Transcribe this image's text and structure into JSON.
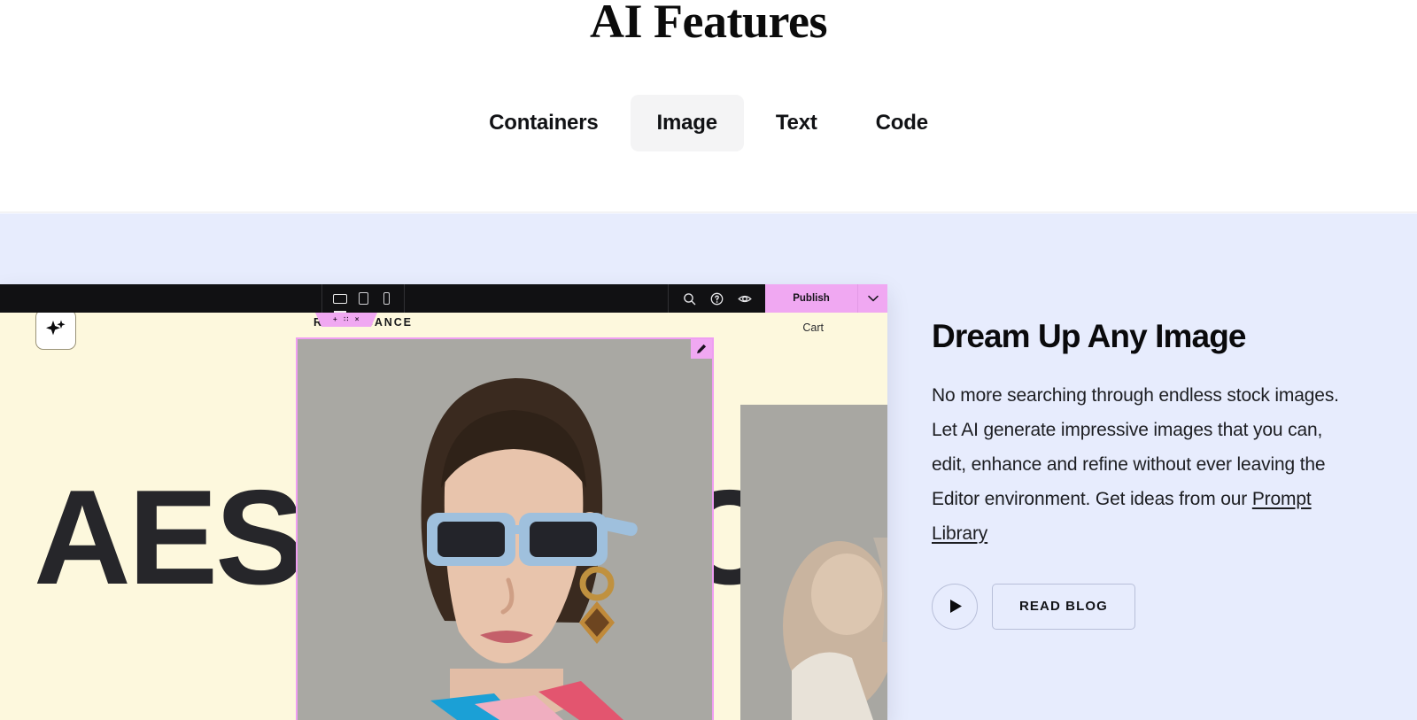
{
  "header": {
    "title": "AI Features",
    "tabs": [
      {
        "label": "Containers",
        "active": false
      },
      {
        "label": "Image",
        "active": true
      },
      {
        "label": "Text",
        "active": false
      },
      {
        "label": "Code",
        "active": false
      }
    ]
  },
  "editor": {
    "devices": [
      {
        "name": "desktop-view",
        "selected": true
      },
      {
        "name": "tablet-view",
        "selected": false
      },
      {
        "name": "mobile-view",
        "selected": false
      }
    ],
    "section_chip": {
      "add": "+",
      "drag": "∷",
      "close": "×"
    },
    "tools": [
      {
        "name": "search-icon"
      },
      {
        "name": "help-icon"
      },
      {
        "name": "preview-eye-icon"
      }
    ],
    "publish_label": "Publish",
    "publish_color": "#F0A8F2",
    "toolbar_color": "#111113"
  },
  "site": {
    "brand": "RENAISSANCE",
    "cart": "Cart",
    "headline": "AESTHETIC",
    "ai_badge": "sparkle-ai-icon",
    "canvas_color": "#FDF8DD",
    "selection_color": "#EF9EF2"
  },
  "feature": {
    "background": "#E7ECFD",
    "title": "Dream Up Any Image",
    "body_before_link": "No more searching through endless stock images. Let AI generate impressive images that you can, edit, enhance and refine without ever leaving the Editor environment. Get ideas from our ",
    "link_label": "Prompt Library",
    "play_label": "play-icon",
    "read_blog_label": "READ BLOG"
  }
}
